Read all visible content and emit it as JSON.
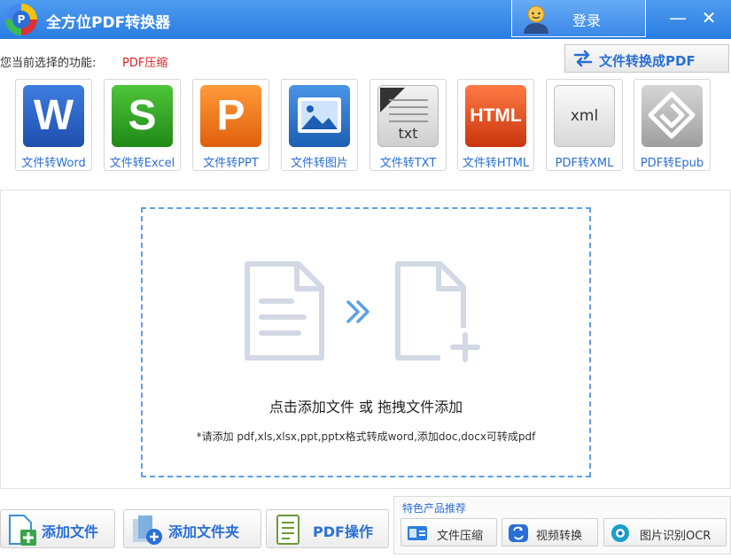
{
  "app": {
    "title": "全方位PDF转换器",
    "logo_letter": "P"
  },
  "header": {
    "login_label": "登录",
    "minimize_glyph": "—",
    "close_glyph": "✕"
  },
  "current": {
    "label": "您当前选择的功能:",
    "value": "PDF压缩"
  },
  "to_pdf": {
    "label": "文件转换成PDF"
  },
  "tools": [
    {
      "label": "文件转Word",
      "icon_text": "W",
      "color": "#2b62c8"
    },
    {
      "label": "文件转Excel",
      "icon_text": "S",
      "color": "#2f9e22"
    },
    {
      "label": "文件转PPT",
      "icon_text": "P",
      "color": "#f07a14"
    },
    {
      "label": "文件转图片",
      "icon_text": "",
      "color": "#2e7bd0"
    },
    {
      "label": "文件转TXT",
      "icon_text": "txt",
      "color": "#d9d9d9"
    },
    {
      "label": "文件转HTML",
      "icon_text": "HTML",
      "color": "#e8491c"
    },
    {
      "label": "PDF转XML",
      "icon_text": "xml",
      "color": "#e6e6e6"
    },
    {
      "label": "PDF转Epub",
      "icon_text": "",
      "color": "#bdbdbd"
    }
  ],
  "dropzone": {
    "main_text": "点击添加文件 或 拖拽文件添加",
    "hint_text": "*请添加 pdf,xls,xlsx,ppt,pptx格式转成word,添加doc,docx可转成pdf"
  },
  "actions": {
    "add_file": "添加文件",
    "add_folder": "添加文件夹",
    "pdf_ops": "PDF操作"
  },
  "featured": {
    "title": "特色产品推荐",
    "items": [
      {
        "label": "文件压缩"
      },
      {
        "label": "视频转换"
      },
      {
        "label": "图片识别OCR"
      }
    ]
  },
  "colors": {
    "accent": "#2a7de1",
    "link": "#2a6fd6",
    "warning": "#e02020"
  }
}
